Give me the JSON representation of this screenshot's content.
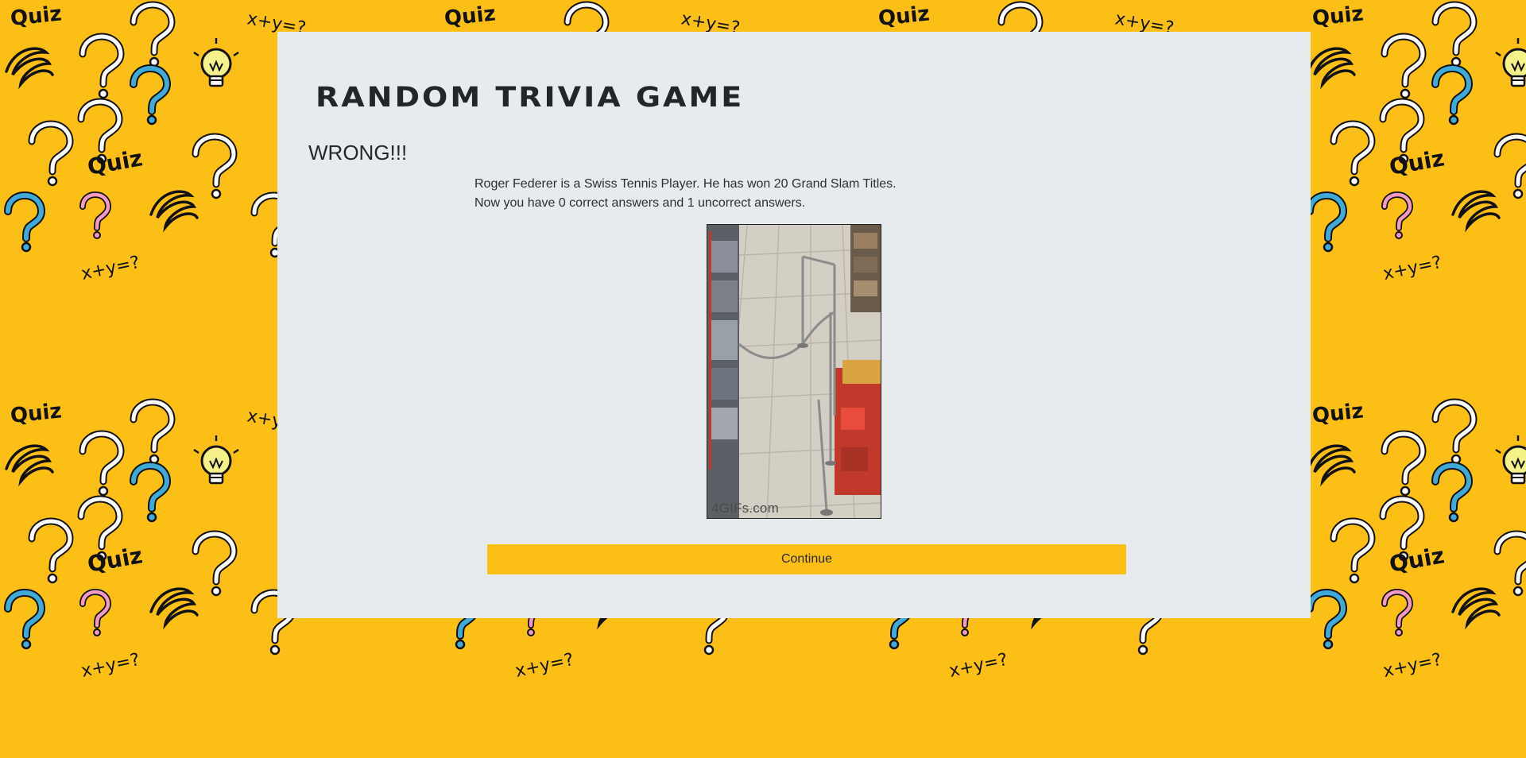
{
  "colors": {
    "page_background": "#fbbf15",
    "card_background": "#e8ebee",
    "button_background": "#fbbf15",
    "text_dark": "#22262b"
  },
  "background": {
    "doodle_words": [
      "Quiz",
      "x+y=?"
    ],
    "doodle_icons": [
      "question-mark-icon",
      "light-bulb-icon",
      "scribble-icon"
    ]
  },
  "game": {
    "title": "RANDOM TRIVIA GAME",
    "result": "WRONG!!!",
    "explanation": "Roger Federer is a Swiss Tennis Player. He has won 20 Grand Slam Titles.",
    "score_text": "Now you have 0 correct answers and 1 uncorrect answers.",
    "gif_watermark": "4GIFs.com",
    "continue_label": "Continue"
  }
}
